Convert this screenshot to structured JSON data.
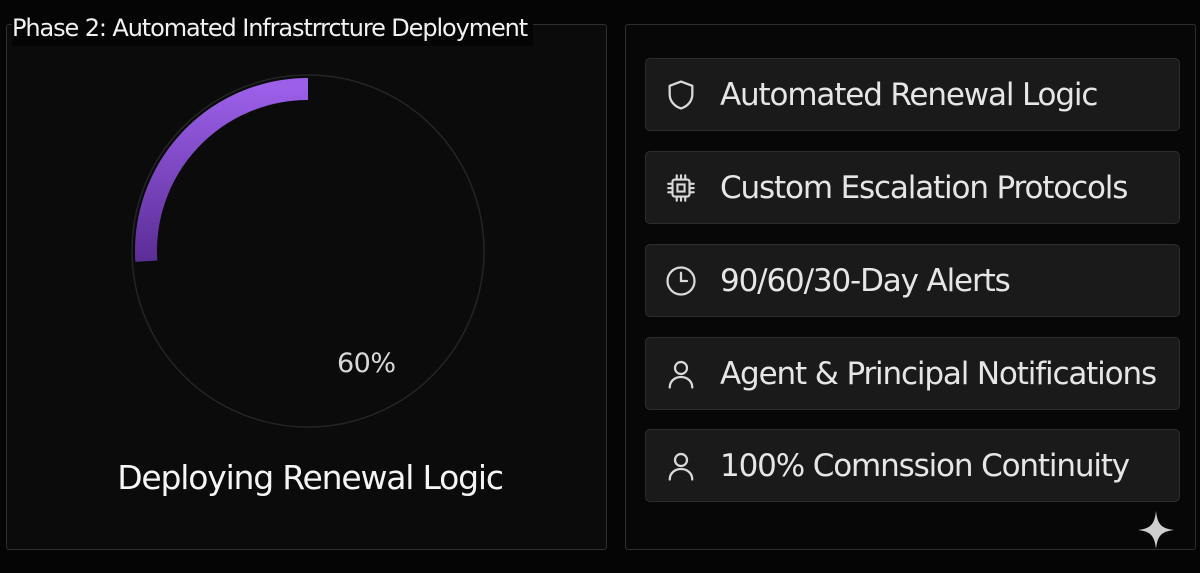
{
  "phase": {
    "title": "Phase 2: Automated Infrastrrcture Deployment"
  },
  "progress": {
    "percent_label": "60%",
    "fraction_shown": 0.26,
    "status": "Deploying Renewal Logic",
    "color_start": "#9b5fe8",
    "color_end": "#5b2d96",
    "track_color": "#242424"
  },
  "features": [
    {
      "icon": "shield-icon",
      "label": "Automated Renewal Logic"
    },
    {
      "icon": "chip-icon",
      "label": "Custom Escalation Protocols"
    },
    {
      "icon": "clock-icon",
      "label": "90/60/30-Day Alerts"
    },
    {
      "icon": "user-icon",
      "label": "Agent & Principal Notifications"
    },
    {
      "icon": "user-icon",
      "label": "100% Comnssion Continuity"
    }
  ],
  "watermark": {
    "icon": "sparkle-icon"
  }
}
